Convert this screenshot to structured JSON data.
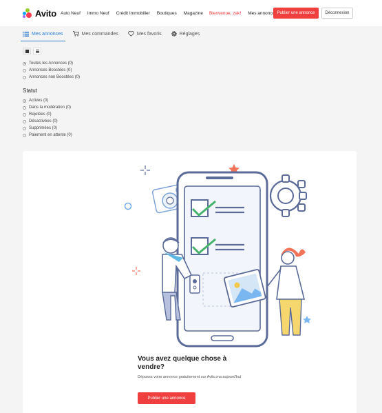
{
  "header": {
    "logo_text": "Avito",
    "nav": [
      "Auto Neuf",
      "Immo Neuf",
      "Crédit Immobilier",
      "Boutiques",
      "Magazine"
    ],
    "greeting": "Bienvenue, zak!",
    "my_ads": "Mes annonces",
    "publish_button": "Publier une annonce",
    "logout_button": "Déconnexion",
    "colors": {
      "accent": "#ef3f3f",
      "greeting": "#e33333"
    }
  },
  "tabs": [
    {
      "label": "Mes annonces",
      "icon": "list-icon",
      "active": true
    },
    {
      "label": "Mes commandes",
      "icon": "cart-icon",
      "active": false
    },
    {
      "label": "Mes favoris",
      "icon": "heart-icon",
      "active": false
    },
    {
      "label": "Réglages",
      "icon": "gear-icon",
      "active": false
    }
  ],
  "view_toggles": [
    "grid-view-icon",
    "list-view-icon"
  ],
  "filters": {
    "ad_types": [
      {
        "label": "Toutes les Annonces (0)",
        "checked": true
      },
      {
        "label": "Annonces Boostées (0)",
        "checked": false
      },
      {
        "label": "Annonces non Boostées (0)",
        "checked": false
      }
    ],
    "status_title": "Statut",
    "statuses": [
      {
        "label": "Actives (0)",
        "checked": true
      },
      {
        "label": "Dans la modération (0)",
        "checked": false
      },
      {
        "label": "Rejetées (0)",
        "checked": false
      },
      {
        "label": "Désactivées (0)",
        "checked": false
      },
      {
        "label": "Supprimées (0)",
        "checked": false
      },
      {
        "label": "Paiement en attente (0)",
        "checked": false
      }
    ]
  },
  "empty_state": {
    "title": "Vous avez quelque chose à vendre?",
    "description": "Déposez votre annonce gratuitement sur Avito.ma aujourd'hui",
    "button": "Publier une annonce"
  }
}
